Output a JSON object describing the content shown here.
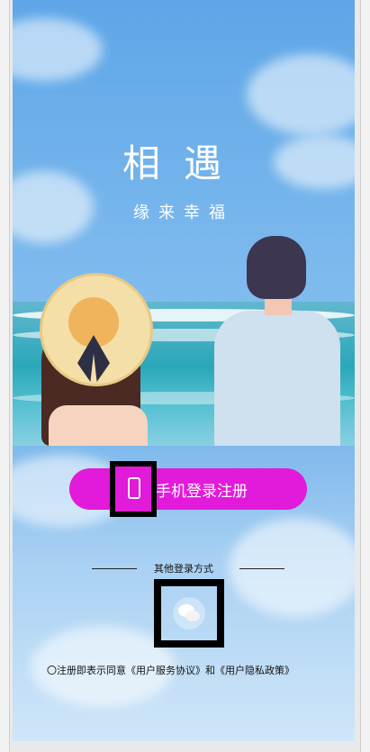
{
  "hero": {
    "title": "相遇",
    "subtitle": "缘来幸福"
  },
  "login": {
    "phone_button_label": "手机登录注册",
    "other_methods_label": "其他登录方式"
  },
  "agreement": {
    "radio": "〇",
    "prefix": "注册即表示同意",
    "service_link": "《用户服务协议》",
    "and": "和",
    "privacy_link": "《用户隐私政策》"
  },
  "icons": {
    "phone": "phone-icon",
    "wechat": "wechat-icon"
  },
  "colors": {
    "accent": "#e21ad9",
    "sky": "#5ea6e8",
    "sea": "#2aa7b9"
  }
}
